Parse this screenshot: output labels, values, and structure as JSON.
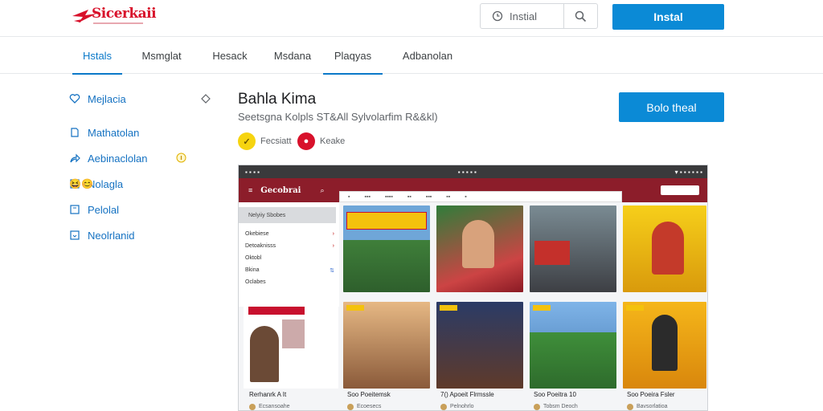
{
  "brand": {
    "logo_text": "Sicerkaii",
    "accent": "#0b8ad6",
    "brand_red": "#d8112b"
  },
  "header": {
    "search_placeholder": "Instial",
    "search_icon": "magnifier-icon",
    "clock_icon": "clock-icon",
    "install_label": "Instal"
  },
  "tabs": [
    {
      "label": "Hstals",
      "active": true
    },
    {
      "label": "Msmglat",
      "active": false
    },
    {
      "label": "Hesack",
      "active": false
    },
    {
      "label": "Msdana",
      "active": false
    },
    {
      "label": "Plaqyas",
      "active": false
    },
    {
      "label": "Adbanolan",
      "active": false
    }
  ],
  "sidebar": {
    "items": [
      {
        "label": "Mejlacia",
        "icon": "heart-icon"
      },
      {
        "label": "Mathatolan",
        "icon": "file-icon"
      },
      {
        "label": "Aebinaclolan",
        "icon": "share-icon"
      },
      {
        "label": "Nolagla",
        "icon": "image-icon"
      },
      {
        "label": "Pelolal",
        "icon": "box-icon"
      },
      {
        "label": "Neolrlanid",
        "icon": "window-icon"
      }
    ],
    "emoji": "😆😊"
  },
  "app": {
    "title": "Bahla Kima",
    "subtitle": "Seetsgna Kolpls ST&All Sylvolarfim R&&kl)",
    "badge_1": "Fecsiatt",
    "badge_2": "Keake",
    "primary_button": "Bolo theal"
  },
  "screenshot": {
    "menu_head": "Nelyiiy Sbobes",
    "menu_items": [
      "Okebiese",
      "Detoaknisss",
      "Oktobl",
      "Bkina",
      "Oclabes"
    ],
    "mini_logo": "Gecobrai",
    "captions": [
      {
        "title": "Rerhanrk A  It",
        "sub": "Ecsansoahe"
      },
      {
        "title": "Soo Poeitemsk",
        "sub": "Ecoesecs"
      },
      {
        "title": "7() Apoeit Flrmssle",
        "sub": "Pelnohrlo"
      },
      {
        "title": "Soo Poeitra 10",
        "sub": "Tobsm Deoch"
      },
      {
        "title": "Soo Poeira Fsler",
        "sub": "Bavsorlatioa"
      }
    ]
  }
}
